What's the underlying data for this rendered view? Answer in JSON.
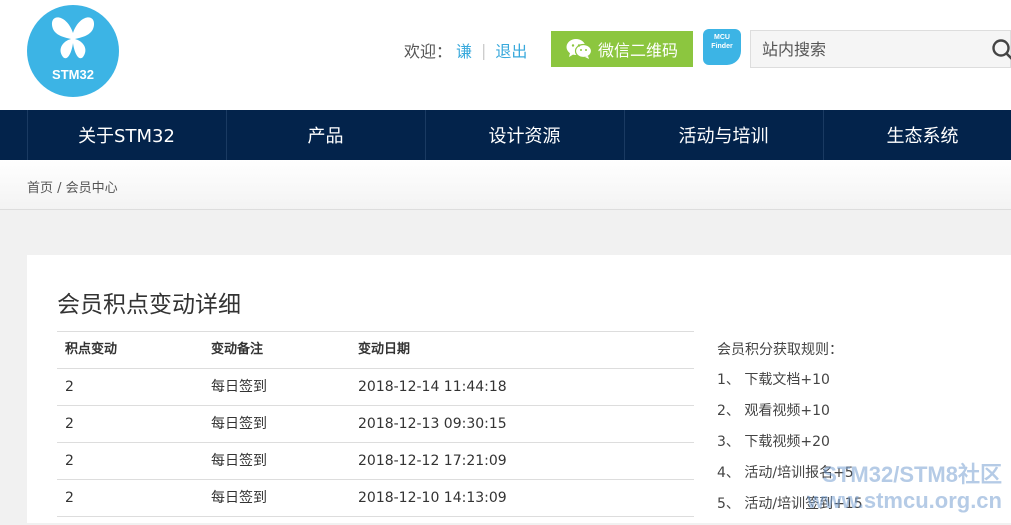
{
  "header": {
    "logo_text": "STM32",
    "welcome_label": "欢迎：",
    "username": "谦",
    "logout_label": "退出",
    "wechat_button": "微信二维码",
    "mcu_finder_line1": "MCU",
    "mcu_finder_line2": "Finder",
    "search_placeholder": "站内搜索"
  },
  "nav": {
    "items": [
      "关于STM32",
      "产品",
      "设计资源",
      "活动与培训",
      "生态系统"
    ]
  },
  "breadcrumb": "首页 / 会员中心",
  "main": {
    "title": "会员积点变动详细",
    "columns": [
      "积点变动",
      "变动备注",
      "变动日期"
    ],
    "rows": [
      [
        "2",
        "每日签到",
        "2018-12-14 11:44:18"
      ],
      [
        "2",
        "每日签到",
        "2018-12-13 09:30:15"
      ],
      [
        "2",
        "每日签到",
        "2018-12-12 17:21:09"
      ],
      [
        "2",
        "每日签到",
        "2018-12-10 14:13:09"
      ]
    ]
  },
  "rules": {
    "title": "会员积分获取规则：",
    "items": [
      "1、 下载文档+10",
      "2、 观看视频+10",
      "3、 下载视频+20",
      "4、 活动/培训报名+5",
      "5、 活动/培训签到+15"
    ]
  },
  "watermark": {
    "line1": "STM32/STM8社区",
    "line2": "www.stmcu.org.cn"
  },
  "colors": {
    "brand_blue": "#3cb4e5",
    "nav_bg": "#03234b",
    "wechat_green": "#8cc63f",
    "link_blue": "#39a9dc"
  }
}
